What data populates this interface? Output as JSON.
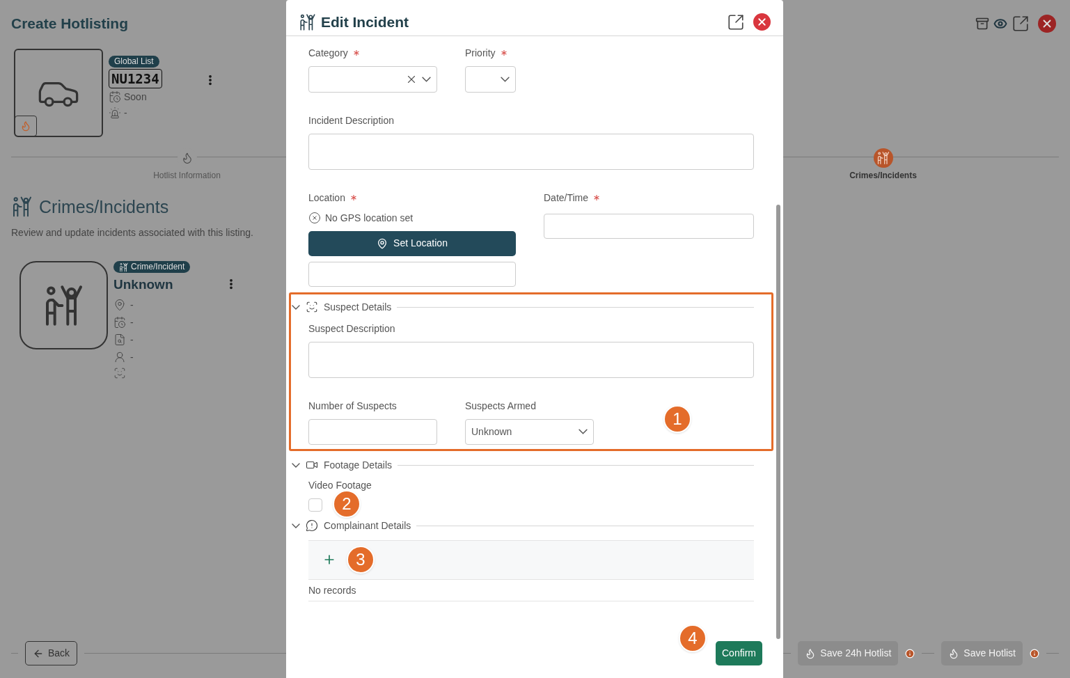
{
  "page": {
    "title": "Create Hotlisting"
  },
  "vehicle": {
    "badge": "Global List",
    "plate": "NU1234",
    "when": "Soon",
    "alert": "-"
  },
  "steps": [
    {
      "label": "Hotlist Information",
      "selected": false
    },
    {
      "label": "Crimes/Incidents",
      "selected": true
    }
  ],
  "section": {
    "title": "Crimes/Incidents",
    "subtitle": "Review and update incidents associated with this listing."
  },
  "incident_card": {
    "badge": "Crime/Incident",
    "title": "Unknown",
    "location": "-",
    "date": "-",
    "report": "-",
    "officer": "-"
  },
  "footer": {
    "back": "Back",
    "buttons": [
      {
        "label": "Save 24h Hotlist",
        "disabled": true
      },
      {
        "label": "Save Hotlist",
        "disabled": true
      }
    ]
  },
  "modal": {
    "title": "Edit Incident",
    "category": {
      "label": "Category",
      "required": true
    },
    "priority": {
      "label": "Priority",
      "required": true
    },
    "description": {
      "label": "Incident Description"
    },
    "location": {
      "label": "Location",
      "required": true,
      "status": "No GPS location set",
      "button": "Set Location"
    },
    "datetime": {
      "label": "Date/Time",
      "required": true
    },
    "sections": [
      {
        "kind": "suspect",
        "title": "Suspect Details",
        "expanded": true,
        "highlighted": true,
        "description_label": "Suspect Description",
        "count_label": "Number of Suspects",
        "armed_label": "Suspects Armed",
        "armed_value": "Unknown"
      },
      {
        "kind": "footage",
        "title": "Footage Details",
        "expanded": true,
        "highlighted": false,
        "checkbox_label": "Video Footage",
        "checked": false
      },
      {
        "kind": "complainant",
        "title": "Complainant Details",
        "expanded": true,
        "highlighted": false,
        "empty_text": "No records"
      }
    ],
    "confirm": "Confirm"
  },
  "callouts": [
    {
      "number": "1"
    },
    {
      "number": "2"
    },
    {
      "number": "3"
    },
    {
      "number": "4"
    }
  ]
}
